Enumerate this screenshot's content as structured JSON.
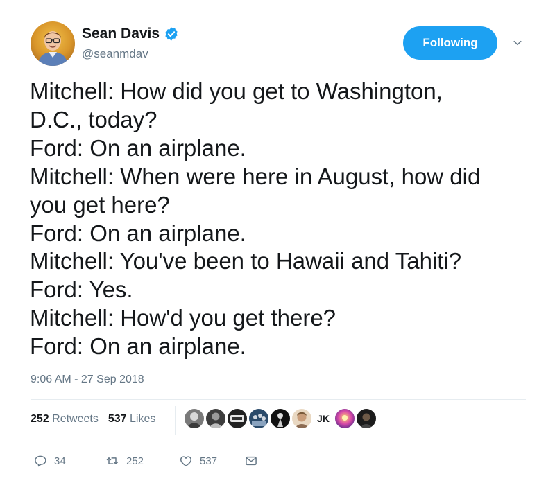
{
  "author": {
    "display_name": "Sean Davis",
    "handle": "@seanmdav",
    "verified": true
  },
  "follow_button_label": "Following",
  "tweet_lines": [
    "Mitchell: How did you get to Washington,",
    "D.C., today?",
    "Ford: On an airplane.",
    "Mitchell: When were here in August, how did",
    "you get here?",
    "Ford: On an airplane.",
    "Mitchell: You've been to Hawaii and Tahiti?",
    "Ford: Yes.",
    "Mitchell: How'd you get there?",
    "Ford: On an airplane."
  ],
  "timestamp": "9:06 AM - 27 Sep 2018",
  "stats": {
    "retweets_count": "252",
    "retweets_label": "Retweets",
    "likes_count": "537",
    "likes_label": "Likes"
  },
  "liker_initials": "JK",
  "actions": {
    "reply_count": "34",
    "retweet_count": "252",
    "like_count": "537"
  },
  "colors": {
    "accent": "#1da1f2",
    "text": "#14171a",
    "secondary_text": "#657786",
    "divider": "#e6ecf0"
  },
  "icons": [
    "verified-badge-icon",
    "chevron-down-icon",
    "reply-icon",
    "retweet-icon",
    "heart-icon",
    "direct-message-icon"
  ]
}
